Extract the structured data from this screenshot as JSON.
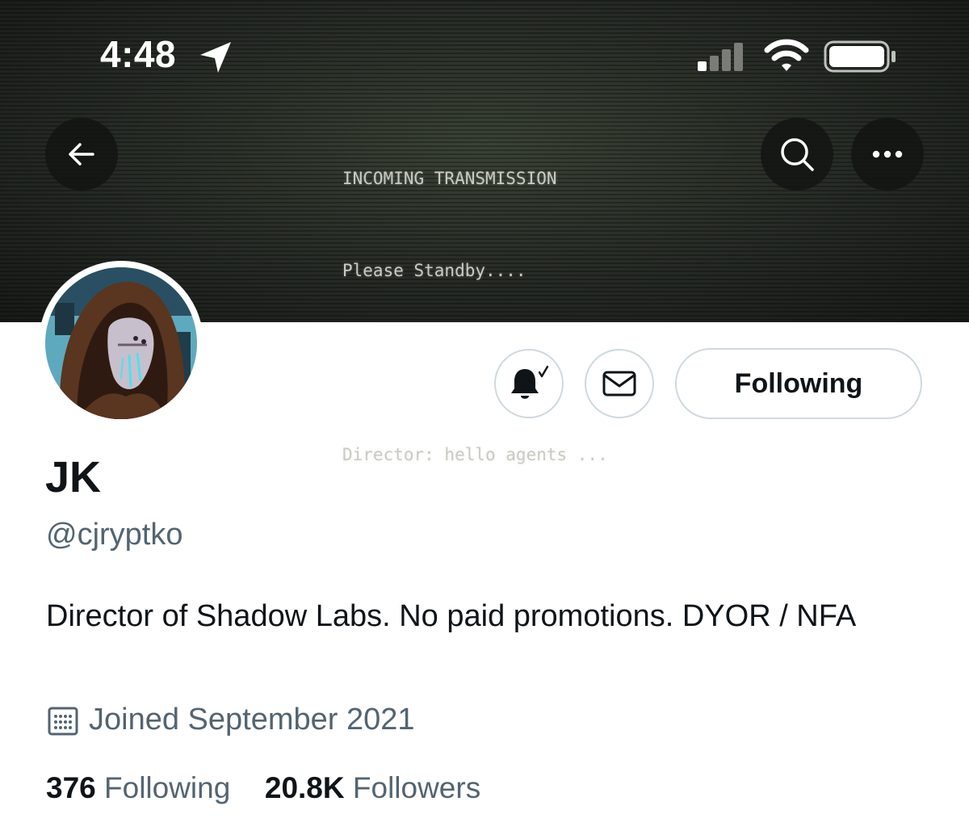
{
  "status_bar": {
    "time": "4:48"
  },
  "banner": {
    "lines": [
      "INCOMING TRANSMISSION",
      "Please Standby....",
      "",
      "Director: hello agents ..."
    ]
  },
  "profile": {
    "name": "JK",
    "handle": "@cjryptko",
    "bio": "Director of Shadow Labs. No paid promotions. DYOR / NFA",
    "joined": "Joined September 2021",
    "following_count": "376",
    "following_label": "Following",
    "followers_count": "20.8K",
    "followers_label": "Followers"
  },
  "actions": {
    "follow_button_label": "Following"
  },
  "icons": {
    "back": "arrow-left-icon",
    "search": "search-icon",
    "more": "more-dots-icon",
    "notifications": "bell-check-icon",
    "message": "envelope-icon",
    "calendar": "calendar-icon"
  },
  "colors": {
    "primary_text": "#0f1419",
    "secondary_text": "#536471",
    "button_border": "#cfd9de"
  }
}
